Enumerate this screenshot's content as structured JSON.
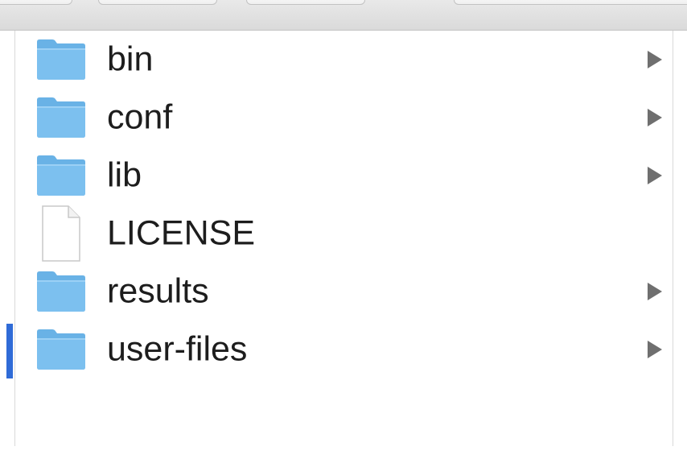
{
  "files": [
    {
      "name": "bin",
      "type": "folder",
      "has_children": true
    },
    {
      "name": "conf",
      "type": "folder",
      "has_children": true
    },
    {
      "name": "lib",
      "type": "folder",
      "has_children": true
    },
    {
      "name": "LICENSE",
      "type": "file",
      "has_children": false
    },
    {
      "name": "results",
      "type": "folder",
      "has_children": true
    },
    {
      "name": "user-files",
      "type": "folder",
      "has_children": true
    }
  ],
  "icons": {
    "folder": "folder-icon",
    "file": "document-icon",
    "expand": "disclosure-triangle-icon"
  },
  "colors": {
    "folder_fill": "#7cc0ef",
    "folder_tab": "#69b2e6",
    "selection_accent": "#2f6bd7",
    "text": "#1d1d1d",
    "chevron": "#6f6f6f"
  }
}
